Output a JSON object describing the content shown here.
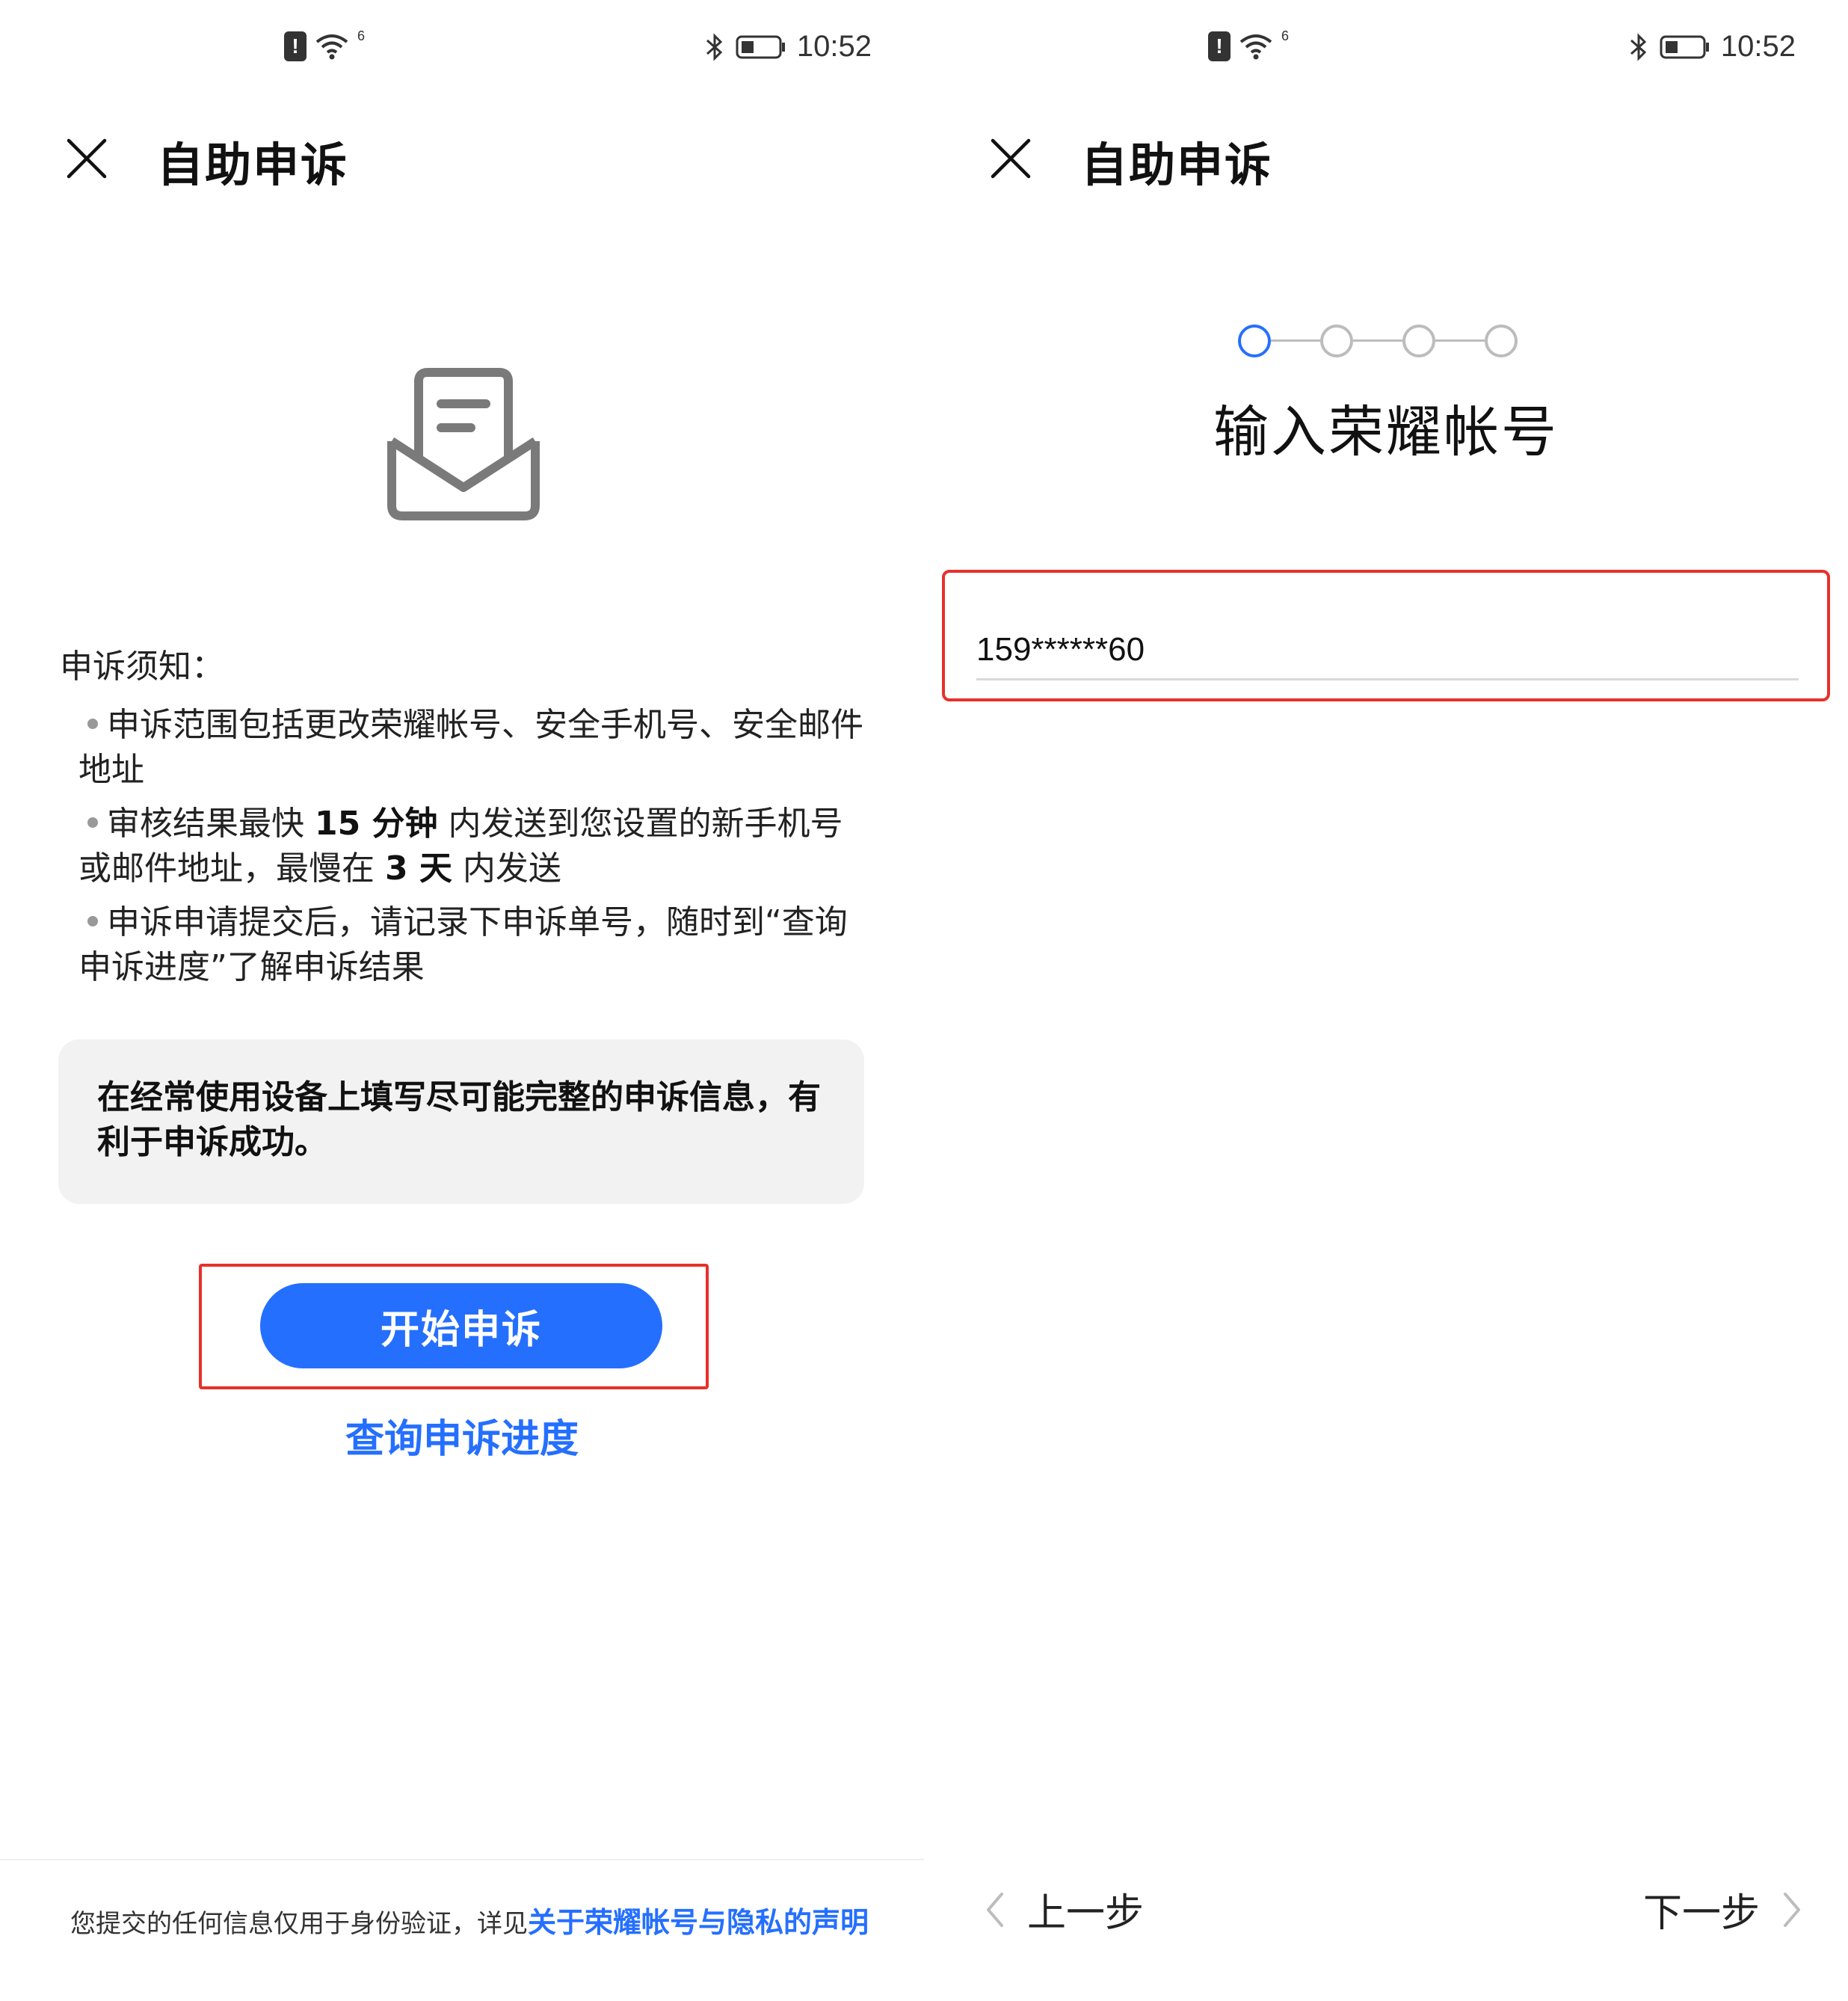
{
  "status_bar": {
    "time": "10:52",
    "network_label": "6"
  },
  "left_screen": {
    "header_title": "自助申诉",
    "notice_title": "申诉须知：",
    "notices": [
      {
        "text": "申诉范围包括更改荣耀帐号、安全手机号、安全邮件地址"
      },
      {
        "pre": "审核结果最快 ",
        "bold1": "15 分钟",
        "mid": " 内发送到您设置的新手机号或邮件地址，最慢在 ",
        "bold2": "3 天",
        "post": " 内发送"
      },
      {
        "text": "申诉申请提交后，请记录下申诉单号，随时到“查询申诉进度”了解申诉结果"
      }
    ],
    "tip": "在经常使用设备上填写尽可能完整的申诉信息，有利于申诉成功。",
    "start_button": "开始申诉",
    "query_link": "查询申诉进度",
    "footer_text": "您提交的任何信息仅用于身份验证，详见",
    "footer_link": "关于荣耀帐号与隐私的声明"
  },
  "right_screen": {
    "header_title": "自助申诉",
    "steps": {
      "total": 4,
      "current": 1
    },
    "step_title": "输入荣耀帐号",
    "account_value": "159******60",
    "prev_label": "上一步",
    "next_label": "下一步"
  },
  "colors": {
    "accent": "#256fff",
    "highlight": "#e8302a",
    "tip_bg": "#f2f2f2"
  }
}
